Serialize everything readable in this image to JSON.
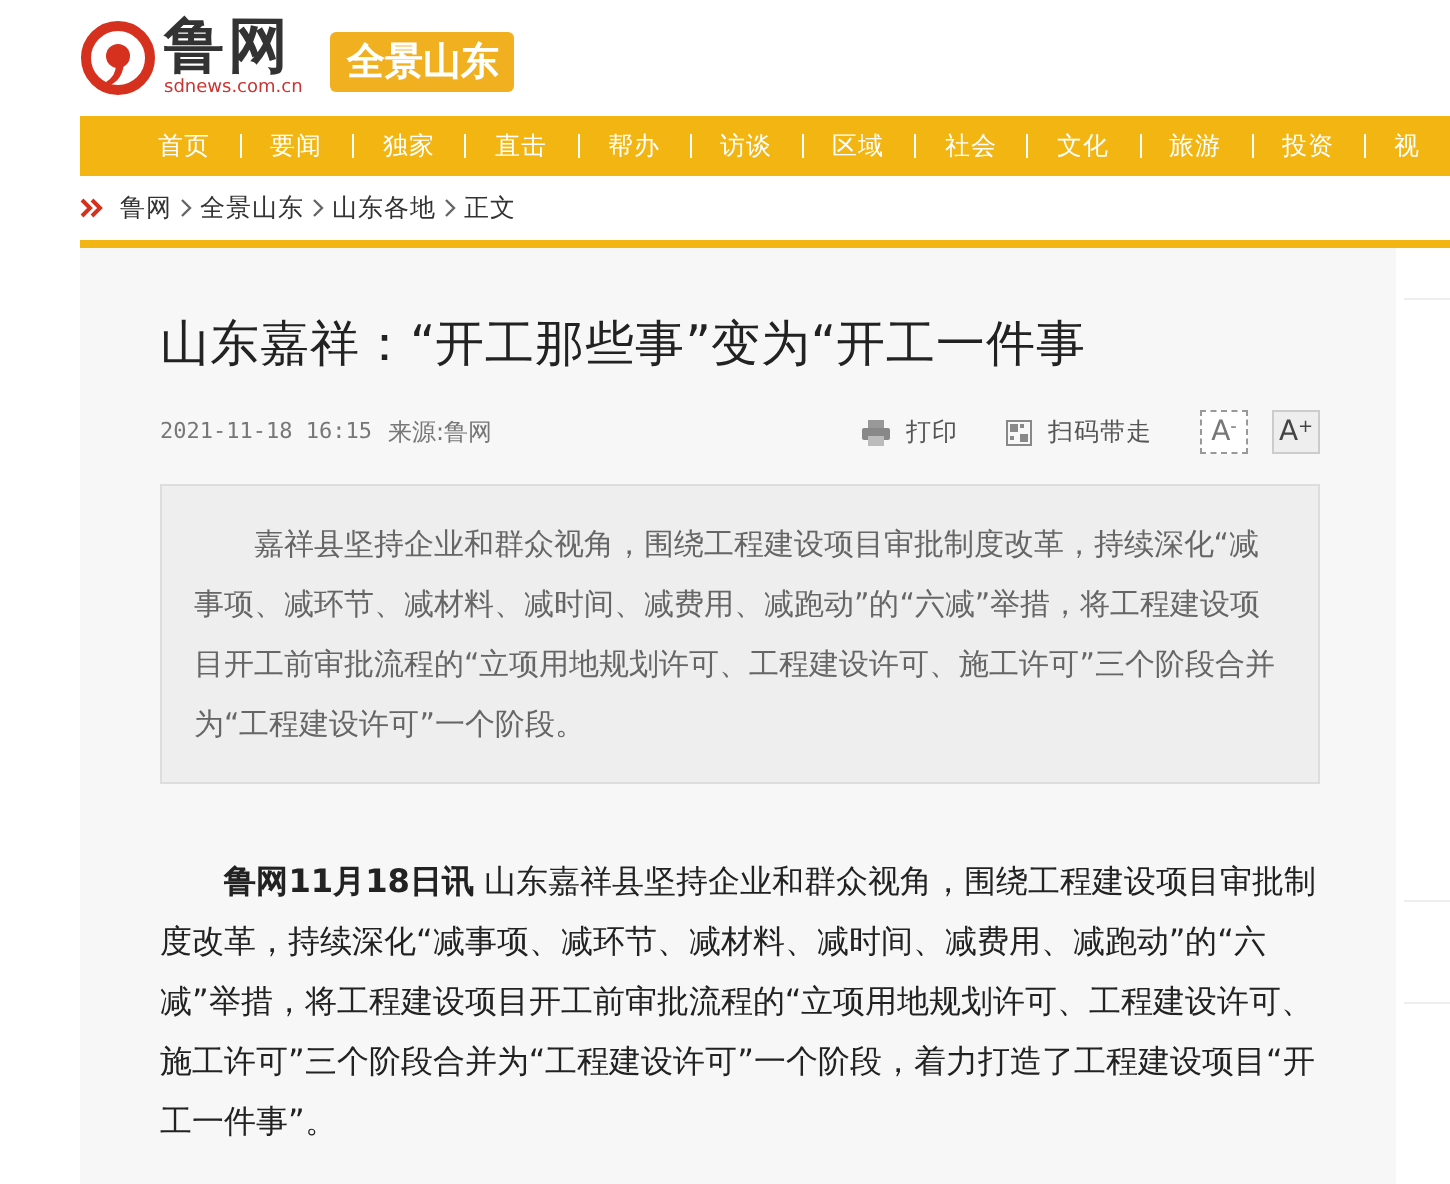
{
  "header": {
    "logo_text": "鲁网",
    "logo_domain": "sdnews.com.cn",
    "channel_badge": "全景山东"
  },
  "nav": [
    "首页",
    "要闻",
    "独家",
    "直击",
    "帮办",
    "访谈",
    "区域",
    "社会",
    "文化",
    "旅游",
    "投资",
    "视"
  ],
  "breadcrumb": [
    "鲁网",
    "全景山东",
    "山东各地",
    "正文"
  ],
  "article": {
    "title": "山东嘉祥：“开工那些事”变为“开工一件事",
    "date": "2021-11-18 16:15",
    "source": "来源:鲁网",
    "tools": [
      {
        "kind": "print",
        "label": "打印"
      },
      {
        "kind": "qr",
        "label": "扫码带走"
      }
    ],
    "font_buttons": [
      {
        "label": "A",
        "sign": "-",
        "selected": false
      },
      {
        "label": "A",
        "sign": "+",
        "selected": true
      }
    ],
    "summary": "嘉祥县坚持企业和群众视角，围绕工程建设项目审批制度改革，持续深化“减事项、减环节、减材料、减时间、减费用、减跑动”的“六减”举措，将工程建设项目开工前审批流程的“立项用地规划许可、工程建设许可、施工许可”三个阶段合并为“工程建设许可”一个阶段。",
    "body": "**鲁网11月18日讯** 山东嘉祥县坚持企业和群众视角，围绕工程建设项目审批制度改革，持续深化“减事项、减环节、减材料、减时间、减费用、减跑动”的“六减”举措，将工程建设项目开工前审批流程的“立项用地规划许可、工程建设许可、施工许可”三个阶段合并为“工程建设许可”一个阶段，着力打造了工程建设项目“开工一件事”。"
  }
}
